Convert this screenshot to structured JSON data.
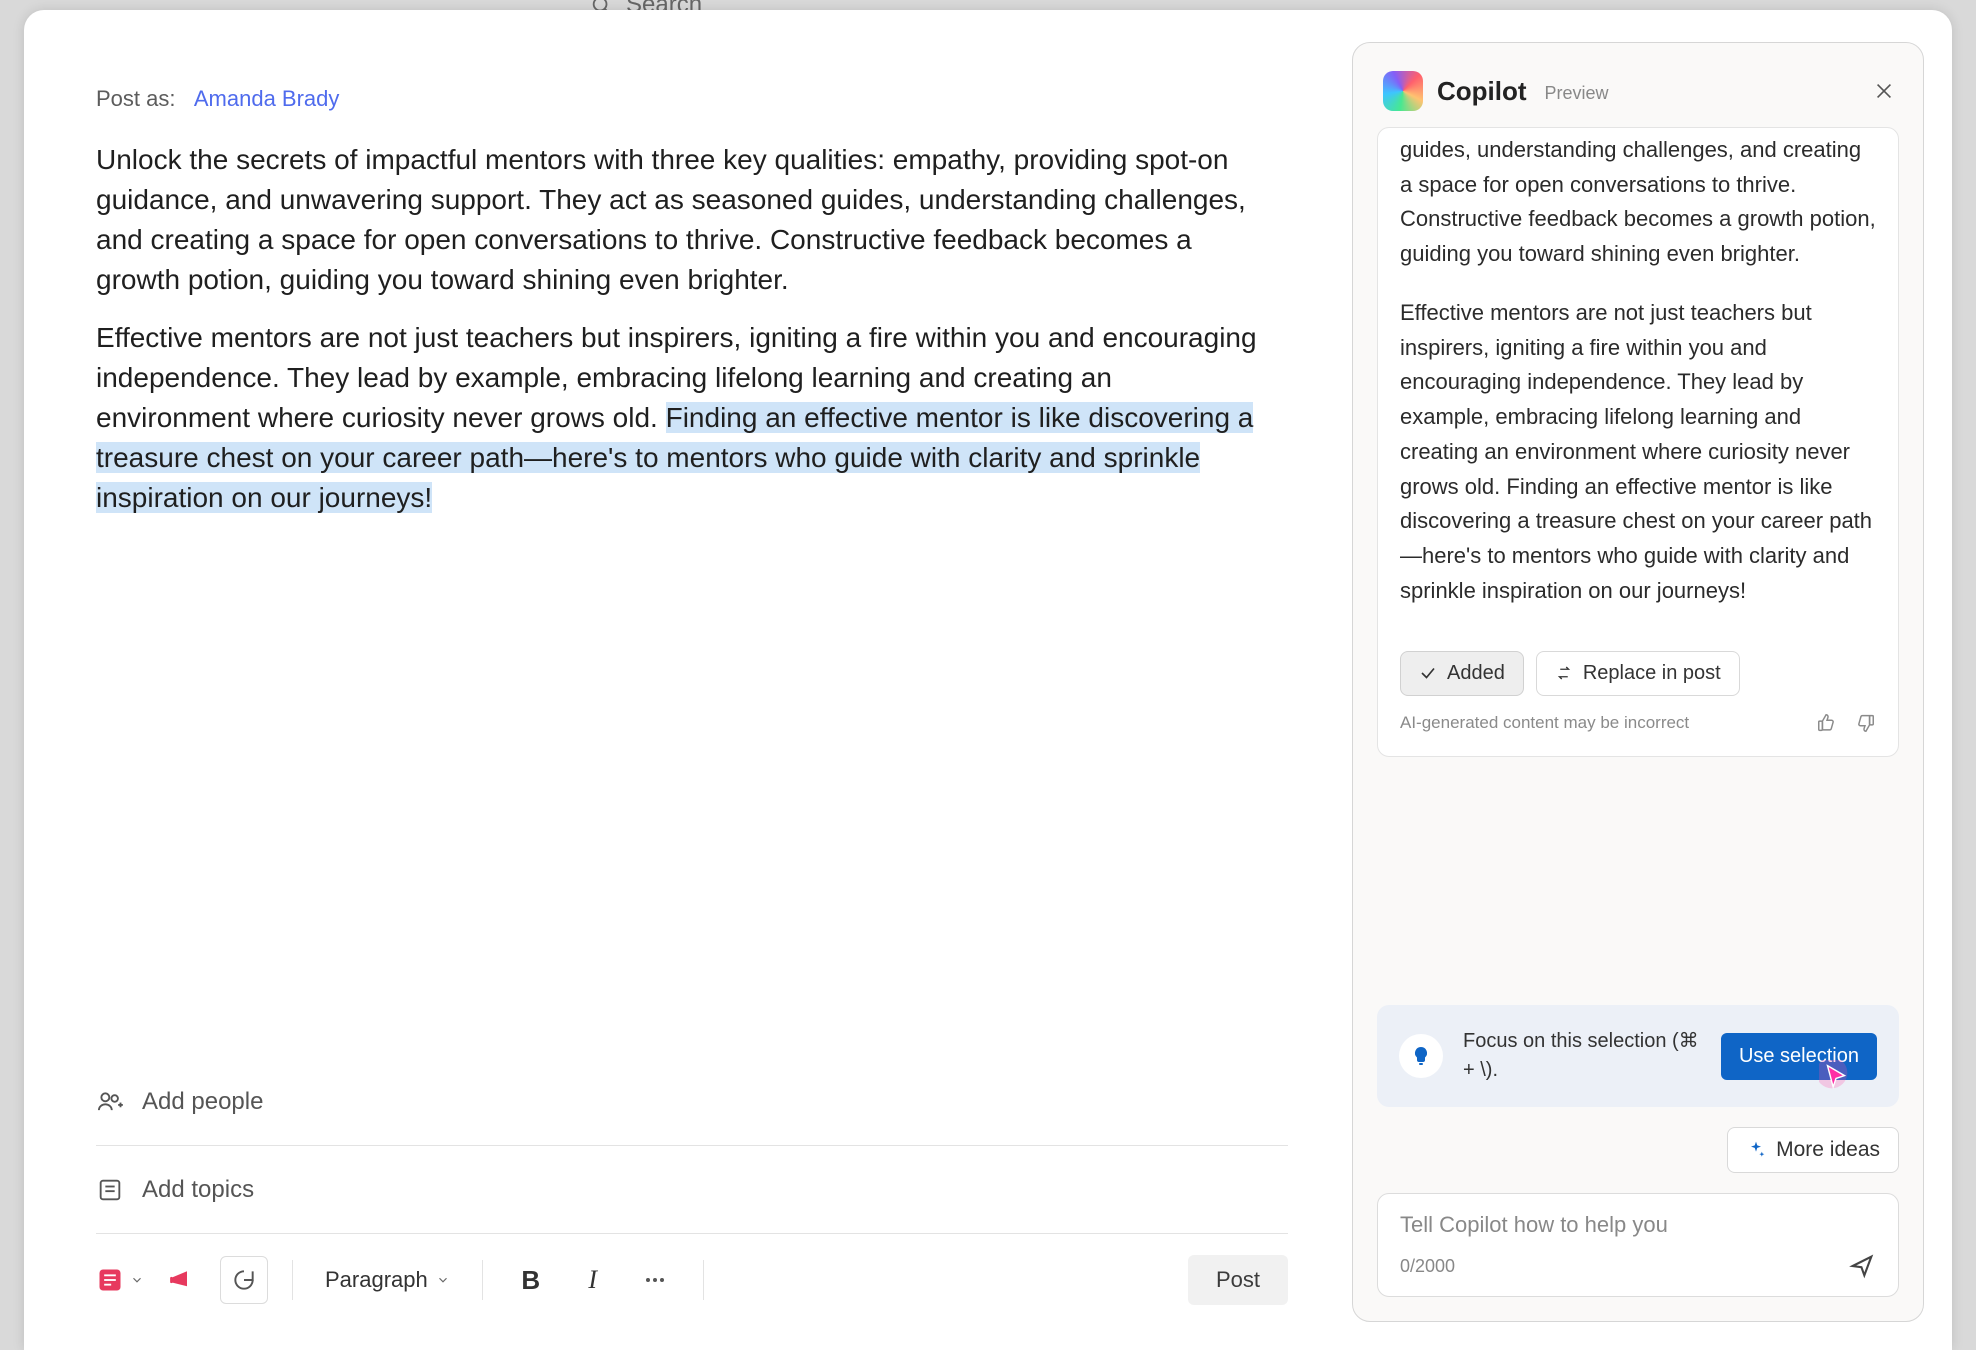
{
  "backdrop": {
    "search_placeholder": "Search"
  },
  "post": {
    "post_as_label": "Post as:",
    "author": "Amanda Brady",
    "para1": "Unlock the secrets of impactful mentors with three key qualities: empathy, providing spot-on guidance, and unwavering support. They act as seasoned guides, understanding challenges, and creating a space for open conversations to thrive. Constructive feedback becomes a growth potion, guiding you toward shining even brighter.",
    "para2_pre": "Effective mentors are not just teachers but inspirers, igniting a fire within you and encouraging independence. They lead by example, embracing lifelong learning and creating an environment where curiosity never grows old. ",
    "para2_sel": "Finding an effective mentor is like discovering a treasure chest on your career path—here's to mentors who guide with clarity and sprinkle inspiration on our journeys!"
  },
  "rows": {
    "add_people": "Add people",
    "add_topics": "Add topics"
  },
  "toolbar": {
    "paragraph_label": "Paragraph",
    "post_label": "Post"
  },
  "copilot": {
    "title": "Copilot",
    "preview": "Preview",
    "response_p1": "unwavering support. They act as seasoned guides, understanding challenges, and creating a space for open conversations to thrive. Constructive feedback becomes a growth potion, guiding you toward shining even brighter.",
    "response_p2": "Effective mentors are not just teachers but inspirers, igniting a fire within you and encouraging independence. They lead by example, embracing lifelong learning and creating an environment where curiosity never grows old. Finding an effective mentor is like discovering a treasure chest on your career path—here's to mentors who guide with clarity and sprinkle inspiration on our journeys!",
    "added_label": "Added",
    "replace_label": "Replace in post",
    "disclaimer": "AI-generated content may be incorrect",
    "tip_text": "Focus on this selection (⌘ + \\).",
    "use_selection": "Use selection",
    "more_ideas": "More ideas",
    "input_placeholder": "Tell Copilot how to help you",
    "counter": "0/2000"
  }
}
